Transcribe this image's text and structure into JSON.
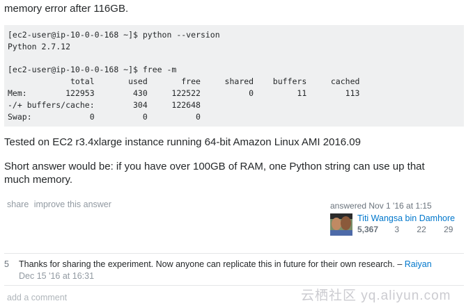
{
  "answer": {
    "intro": "memory error after 116GB.",
    "code_block": "[ec2-user@ip-10-0-0-168 ~]$ python --version\nPython 2.7.12\n\n[ec2-user@ip-10-0-0-168 ~]$ free -m\n             total       used       free     shared    buffers     cached\nMem:        122953        430     122522          0         11        113\n-/+ buffers/cache:        304     122648\nSwap:            0          0          0",
    "paragraph_1": "Tested on EC2 r3.4xlarge instance running 64-bit Amazon Linux AMI 2016.09",
    "paragraph_2": "Short answer would be: if you have over 100GB of RAM, one Python string can use up that much memory."
  },
  "post_menu": {
    "share_label": "share",
    "improve_label": "improve this answer"
  },
  "user_card": {
    "action_time": "answered Nov 1 '16 at 1:15",
    "user_name": "Titi Wangsa bin Damhore",
    "reputation": "5,367",
    "gold_badges": "3",
    "silver_badges": "22",
    "bronze_badges": "29",
    "badge_colors": {
      "gold": "#ffcc01",
      "silver": "#b4b8bc",
      "bronze": "#d1a684"
    }
  },
  "comment": {
    "score": "5",
    "text": "Thanks for sharing the experiment. Now anyone can replicate this in future for their own research. –",
    "author": "Raiyan",
    "date": "Dec 15 '16 at 16:31"
  },
  "add_comment_label": "add a comment",
  "watermark": {
    "cn": "云栖社区",
    "url": "yq.aliyun.com"
  }
}
